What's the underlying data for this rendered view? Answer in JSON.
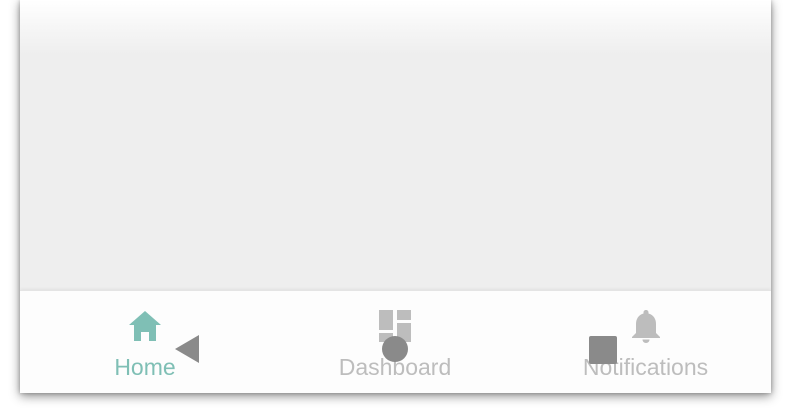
{
  "bottom_nav": {
    "items": [
      {
        "label": "Home",
        "icon": "home-icon",
        "active": true
      },
      {
        "label": "Dashboard",
        "icon": "dashboard-icon",
        "active": false
      },
      {
        "label": "Notifications",
        "icon": "bell-icon",
        "active": false
      }
    ]
  },
  "system_nav": {
    "back": "back-triangle-icon",
    "home": "home-circle-icon",
    "recents": "recents-square-icon"
  },
  "colors": {
    "active": "#7fbfb5",
    "inactive": "#bdbdbd",
    "system_buttons": "#8a8a8a",
    "background": "#eeeeee"
  }
}
